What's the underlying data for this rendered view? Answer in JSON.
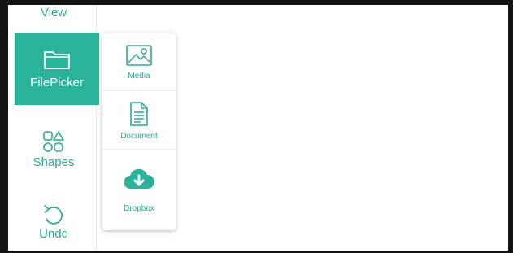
{
  "toolbar": {
    "items": [
      {
        "label": "View",
        "icon": "view-icon"
      },
      {
        "label": "FilePicker",
        "icon": "folder-icon",
        "active": true
      },
      {
        "label": "Shapes",
        "icon": "shapes-icon"
      },
      {
        "label": "Undo",
        "icon": "undo-icon"
      }
    ]
  },
  "filepicker_menu": {
    "items": [
      {
        "label": "Media",
        "icon": "image-icon"
      },
      {
        "label": "Document",
        "icon": "document-icon"
      },
      {
        "label": "Dropbox",
        "icon": "cloud-download-icon"
      }
    ]
  },
  "colors": {
    "accent": "#2ab39a",
    "frame": "#141414",
    "background": "#ffffff"
  }
}
